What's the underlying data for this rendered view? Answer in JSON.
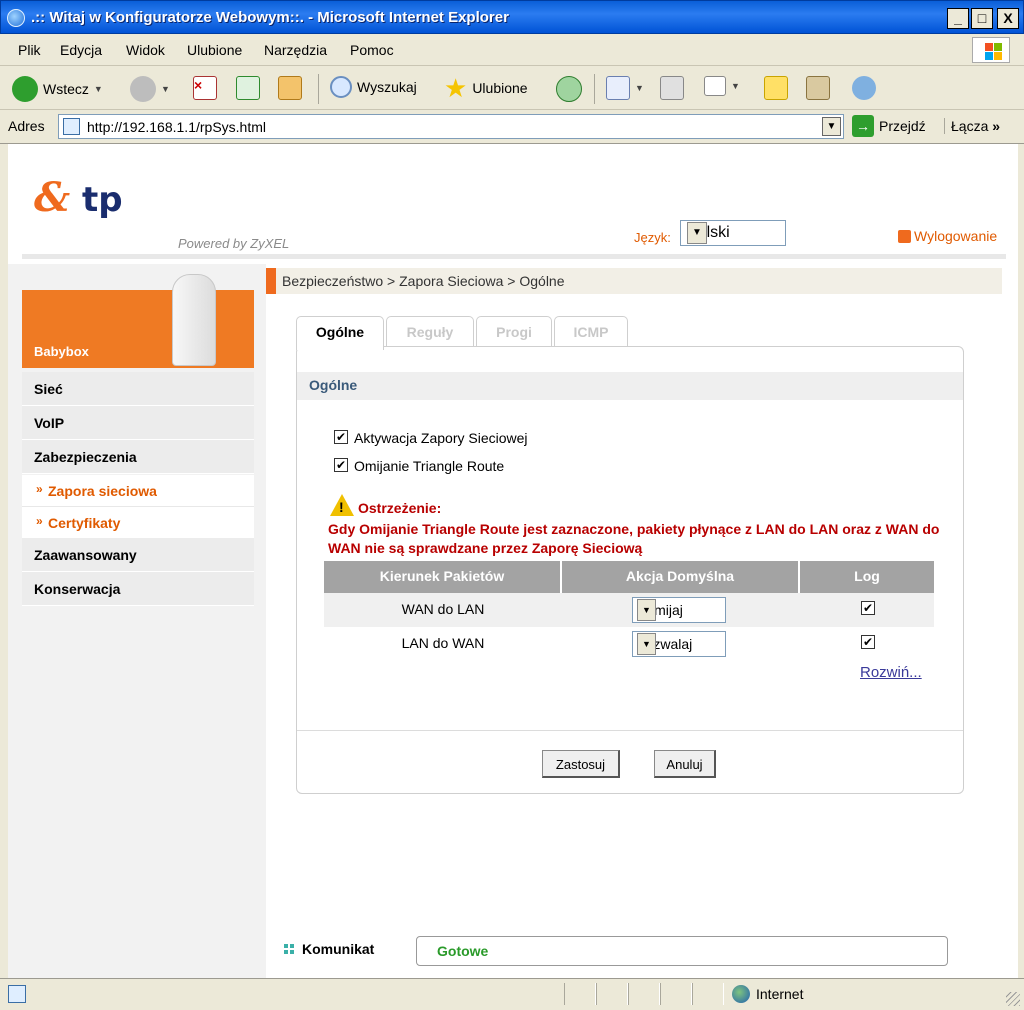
{
  "window": {
    "title": ".:: Witaj w Konfiguratorze Webowym::. - Microsoft Internet Explorer",
    "minimize": "_",
    "maximize": "□",
    "close": "X"
  },
  "menu": [
    "Plik",
    "Edycja",
    "Widok",
    "Ulubione",
    "Narzędzia",
    "Pomoc"
  ],
  "toolbar": {
    "back": "Wstecz",
    "search": "Wyszukaj",
    "favorites": "Ulubione"
  },
  "address": {
    "label": "Adres",
    "url": "http://192.168.1.1/rpSys.html",
    "go": "Przejdź",
    "links": "Łącza",
    "links_chevron": "»"
  },
  "header": {
    "logo_text": "tp",
    "powered_by": "Powered by ZyXEL",
    "language_label": "Język:",
    "language_value": "Polski",
    "logout": "Wylogowanie"
  },
  "sidebar": {
    "device_label": "Babybox",
    "items": [
      {
        "label": "Sieć"
      },
      {
        "label": "VoIP"
      },
      {
        "label": "Zabezpieczenia"
      },
      {
        "label": "Zapora sieciowa"
      },
      {
        "label": "Certyfikaty"
      },
      {
        "label": "Zaawansowany"
      },
      {
        "label": "Konserwacja"
      }
    ]
  },
  "breadcrumb": "Bezpieczeństwo > Zapora Sieciowa > Ogólne",
  "tabs": [
    {
      "label": "Ogólne",
      "active": true
    },
    {
      "label": "Reguły",
      "active": false
    },
    {
      "label": "Progi",
      "active": false
    },
    {
      "label": "ICMP",
      "active": false
    }
  ],
  "section_title": "Ogólne",
  "checkboxes": [
    {
      "label": "Aktywacja Zapory Sieciowej",
      "checked": true
    },
    {
      "label": "Omijanie Triangle Route",
      "checked": true
    }
  ],
  "warning": {
    "title": "Ostrzeżenie:",
    "text": "Gdy Omijanie Triangle Route jest zaznaczone, pakiety płynące z LAN do LAN oraz z WAN do WAN nie są sprawdzane przez Zaporę Sieciową"
  },
  "table": {
    "headers": [
      "Kierunek Pakietów",
      "Akcja Domyślna",
      "Log"
    ],
    "rows": [
      {
        "direction": "WAN do LAN",
        "action": "Pomijaj",
        "log": true
      },
      {
        "direction": "LAN do WAN",
        "action": "Zezwalaj",
        "log": true
      }
    ],
    "expand_link": "Rozwiń..."
  },
  "buttons": {
    "apply": "Zastosuj",
    "cancel": "Anuluj"
  },
  "message": {
    "label": "Komunikat",
    "value": "Gotowe"
  },
  "status": {
    "zone": "Internet"
  },
  "colors": {
    "accent": "#ef6a1e",
    "warning_text": "#b80000",
    "status_ok": "#2a9a2a"
  }
}
